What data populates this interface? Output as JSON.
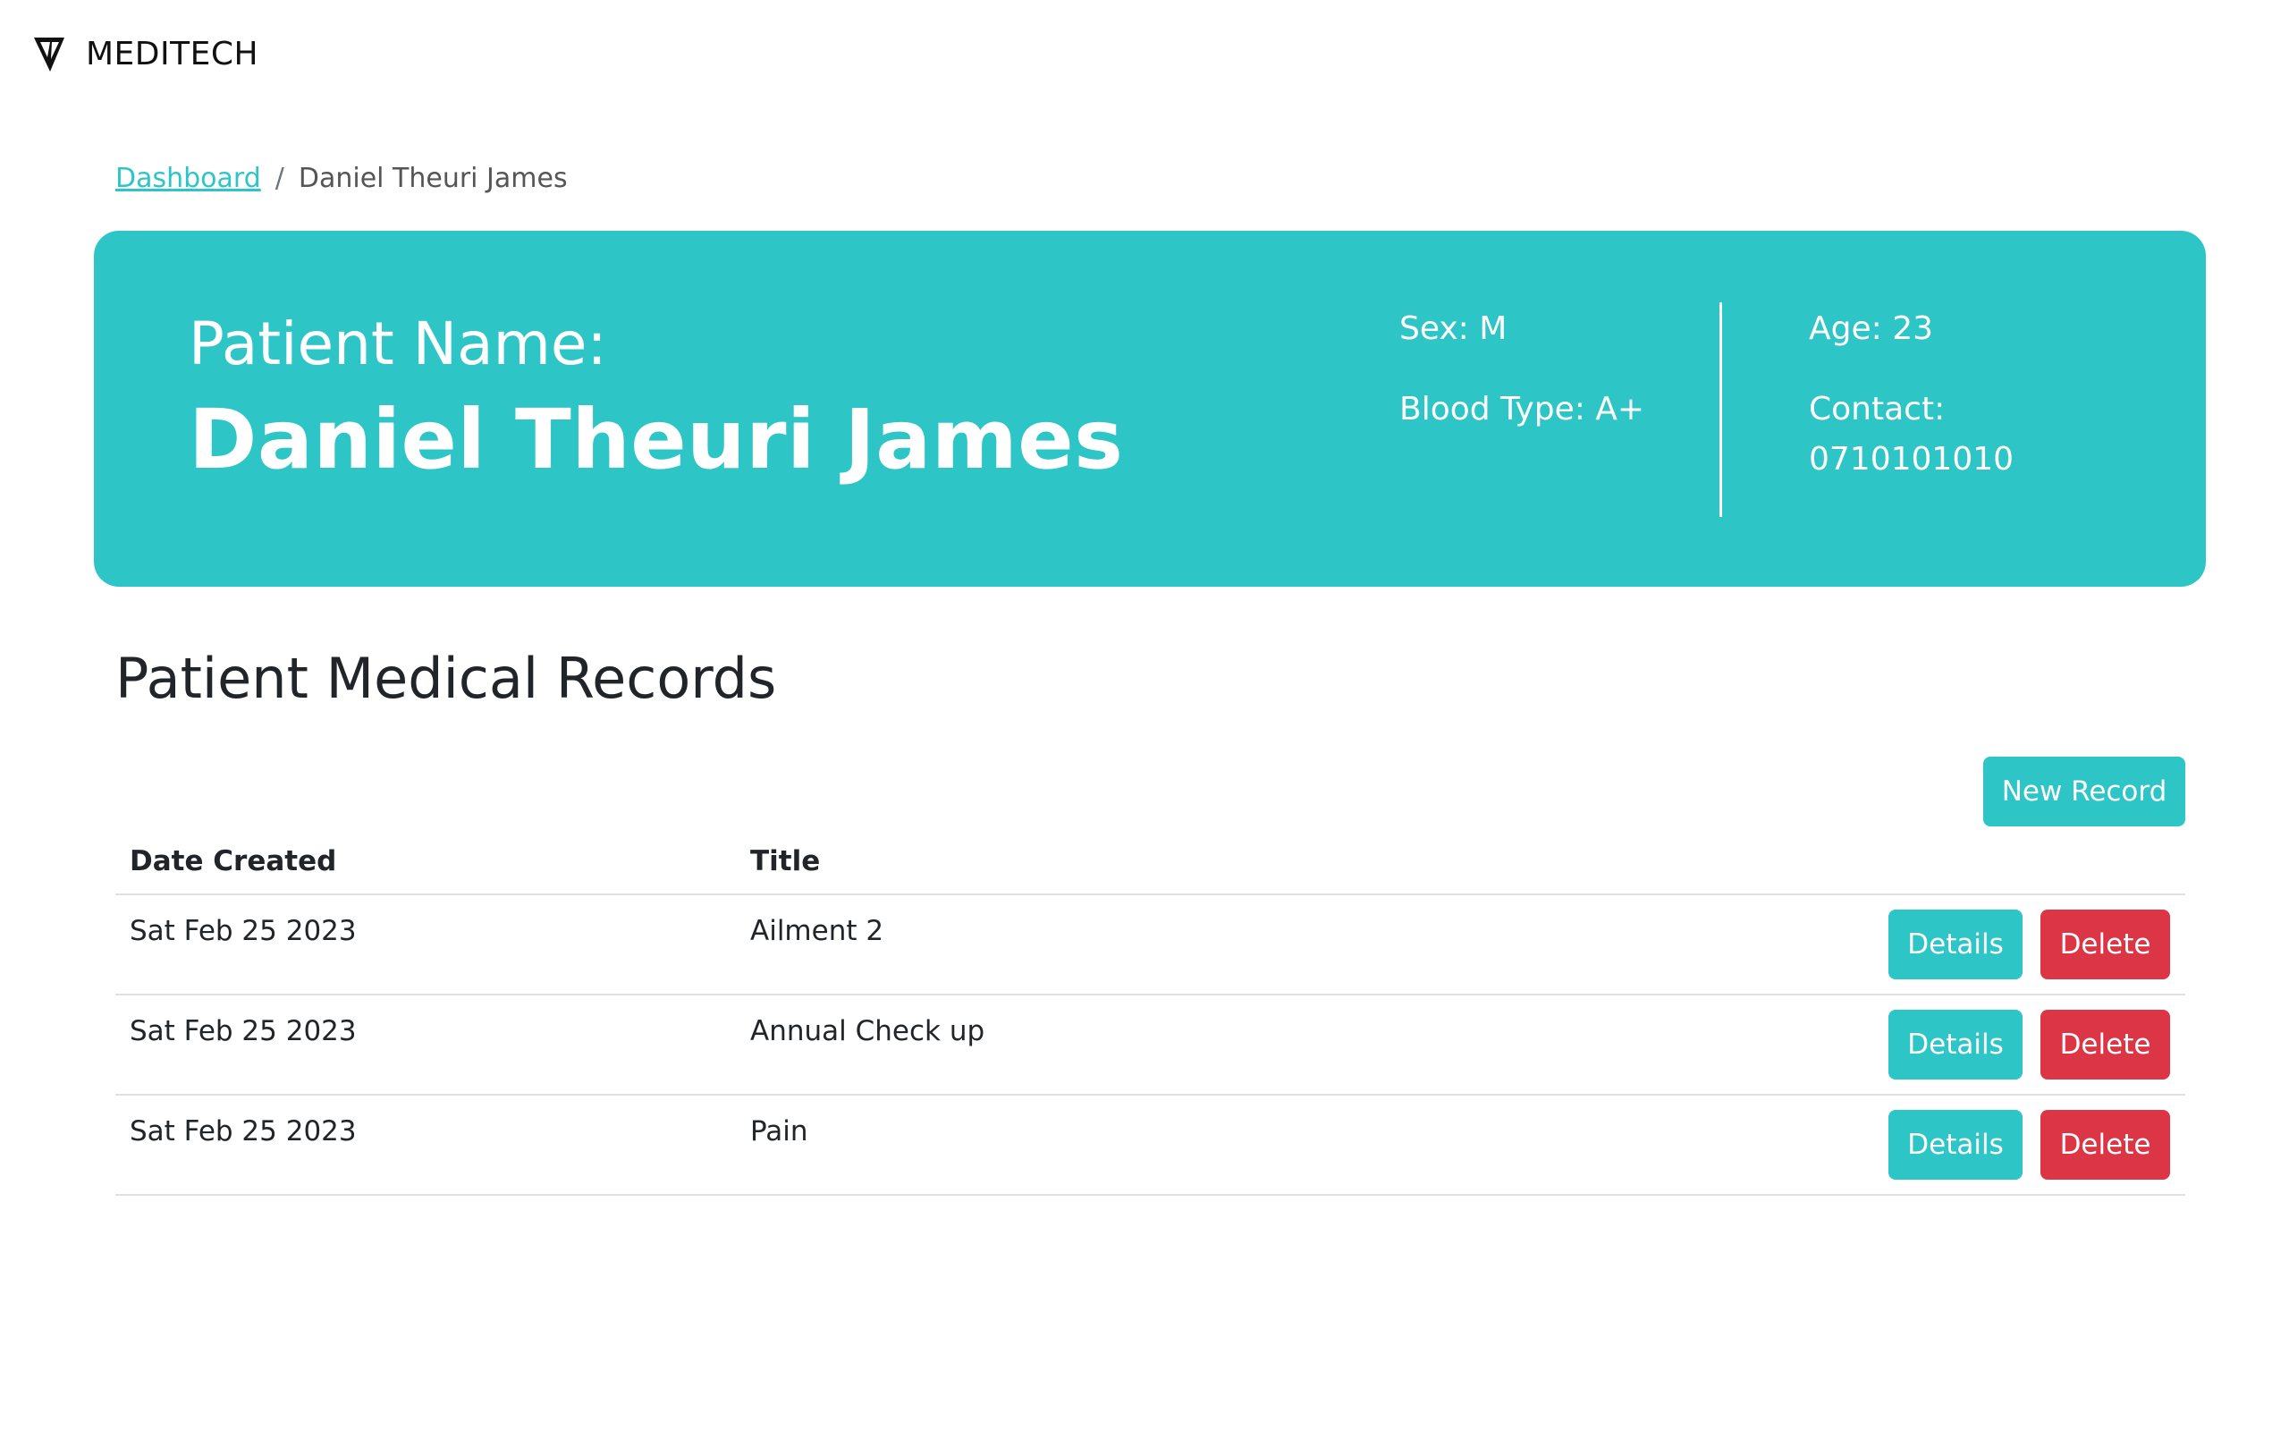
{
  "brand": {
    "name": "MEDITECH",
    "logo_icon": "meditech-logo-icon"
  },
  "breadcrumb": {
    "root": "Dashboard",
    "separator": "/",
    "current": "Daniel Theuri James"
  },
  "patient": {
    "name_label": "Patient Name:",
    "name": "Daniel Theuri James",
    "sex": "Sex: M",
    "blood_type": "Blood Type: A+",
    "age": "Age: 23",
    "contact_label": "Contact:",
    "contact": "0710101010"
  },
  "records": {
    "title": "Patient Medical Records",
    "new_record_label": "New Record",
    "columns": [
      "Date Created",
      "Title"
    ],
    "rows": [
      {
        "date": "Sat Feb 25 2023",
        "title": "Ailment 2",
        "details_label": "Details",
        "delete_label": "Delete"
      },
      {
        "date": "Sat Feb 25 2023",
        "title": "Annual Check up",
        "details_label": "Details",
        "delete_label": "Delete"
      },
      {
        "date": "Sat Feb 25 2023",
        "title": "Pain",
        "details_label": "Details",
        "delete_label": "Delete"
      }
    ]
  },
  "colors": {
    "primary": "#2ec5c7",
    "danger": "#dc3545",
    "text": "#212529",
    "muted": "#6c757d"
  }
}
